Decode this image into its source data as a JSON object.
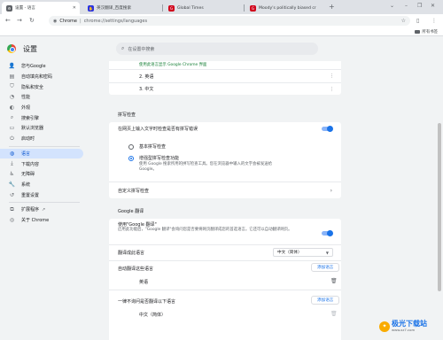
{
  "tabs": [
    {
      "label": "设置 - 语言",
      "active": true,
      "icon": "chrome-gear-icon"
    },
    {
      "label": "英汉翻译_百度搜索",
      "active": false,
      "icon": "baidu-icon"
    },
    {
      "label": "Global Times",
      "active": false,
      "icon": "global-times-icon"
    },
    {
      "label": "Moody's politically biased cr",
      "active": false,
      "icon": "global-times-icon"
    }
  ],
  "toolbar": {
    "site": "Chrome",
    "url": "chrome://settings/languages"
  },
  "bookmarks": {
    "all_bookmarks": "所有书签"
  },
  "header": {
    "title": "设置",
    "search_placeholder": "在设置中搜索"
  },
  "sidebar": {
    "items": [
      {
        "label": "您与Google",
        "icon": "person-icon"
      },
      {
        "label": "自动填充和密码",
        "icon": "document-icon"
      },
      {
        "label": "隐私和安全",
        "icon": "shield-icon"
      },
      {
        "label": "性能",
        "icon": "speedometer-icon"
      },
      {
        "label": "外观",
        "icon": "palette-icon"
      },
      {
        "label": "搜索引擎",
        "icon": "search-icon"
      },
      {
        "label": "默认浏览器",
        "icon": "browser-icon"
      },
      {
        "label": "启动时",
        "icon": "power-icon"
      },
      {
        "label": "语言",
        "icon": "globe-icon",
        "active": true
      },
      {
        "label": "下载内容",
        "icon": "download-icon"
      },
      {
        "label": "无障碍",
        "icon": "accessibility-icon"
      },
      {
        "label": "系统",
        "icon": "wrench-icon"
      },
      {
        "label": "重置设置",
        "icon": "reset-icon"
      }
    ],
    "extensions": {
      "label": "扩展程序",
      "icon": "puzzle-icon"
    },
    "about": {
      "label": "关于 Chrome",
      "icon": "chrome-logo-icon"
    }
  },
  "languages_card": {
    "top_note": "使用此语言显示 Google Chrome 界面",
    "rows": [
      "2. 英语",
      "3. 中文"
    ]
  },
  "spellcheck": {
    "section_title": "拼写检查",
    "toggle_label": "在网页上输入文字时检查是否有拼写错误",
    "basic_label": "基本拼写检查",
    "enhanced_label": "增强型拼写检查功能",
    "enhanced_desc": "使用 Google 搜索所用的拼写检查工具。您在浏览器中输入的文字会被发送给 Google。",
    "custom_label": "自定义拼写检查"
  },
  "translate": {
    "section_title": "Google 翻译",
    "use_label": "使用\"Google 翻译\"",
    "use_desc": "启用此功能后，\"Google 翻译\"会询问您是否要将网页翻译成您的首选语言。它还可以自动翻译网页。",
    "target_label": "翻译成此语言",
    "target_value": "中文（简体）",
    "auto_label": "自动翻译这些语言",
    "auto_add_button": "添加语言",
    "auto_lang": "英语",
    "never_label": "一律不询问是否翻译以下语言",
    "never_add_button": "添加语言",
    "never_lang": "中文（简体）"
  },
  "watermark": {
    "main": "极光下载站",
    "sub": "www.xz7.com"
  },
  "colors": {
    "accent": "#1a73e8",
    "active_bg": "#d3e3fd",
    "tab_strip": "#dee1e6"
  }
}
